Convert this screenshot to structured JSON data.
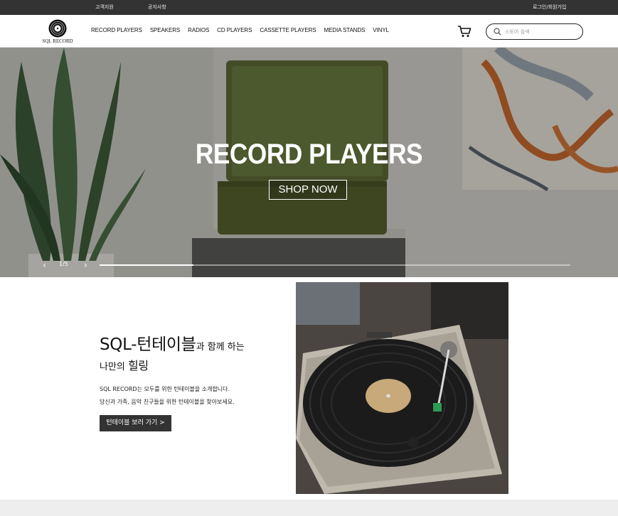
{
  "topbar": {
    "links": [
      "고객지원",
      "공지사항"
    ],
    "account": "로그인/회원가입"
  },
  "header": {
    "logo_text": "SQL RECORD",
    "nav": [
      "RECORD PLAYERS",
      "SPEAKERS",
      "RADIOS",
      "CD PLAYERS",
      "CASSETTE PLAYERS",
      "MEDIA STANDS",
      "VINYL"
    ],
    "search_placeholder": "스토어 검색",
    "cart_icon": "cart-icon",
    "search_icon": "search-icon"
  },
  "hero": {
    "title": "RECORD PLAYERS",
    "button": "SHOP NOW",
    "slide_counter": "1/5",
    "prev_icon": "chevron-left-icon",
    "next_icon": "chevron-right-icon",
    "slide_current": 1,
    "slide_total": 5
  },
  "intro": {
    "heading_big": "SQL-턴테이블",
    "heading_small": "과 함께 하는",
    "heading2_small": "나만의 ",
    "heading2_big": "힐링",
    "text_line1": "SQL RECORD는 모두를 위한 턴테이블을 소개합니다.",
    "text_line2": "당신과 가족, 음악 친구들을 위한 턴테이블을 찾아보세요.",
    "button": "턴테이블 보러 가기 >"
  },
  "colors": {
    "topbar": "#333333",
    "button_dark": "#333333",
    "footer_band": "#eeeeee"
  }
}
